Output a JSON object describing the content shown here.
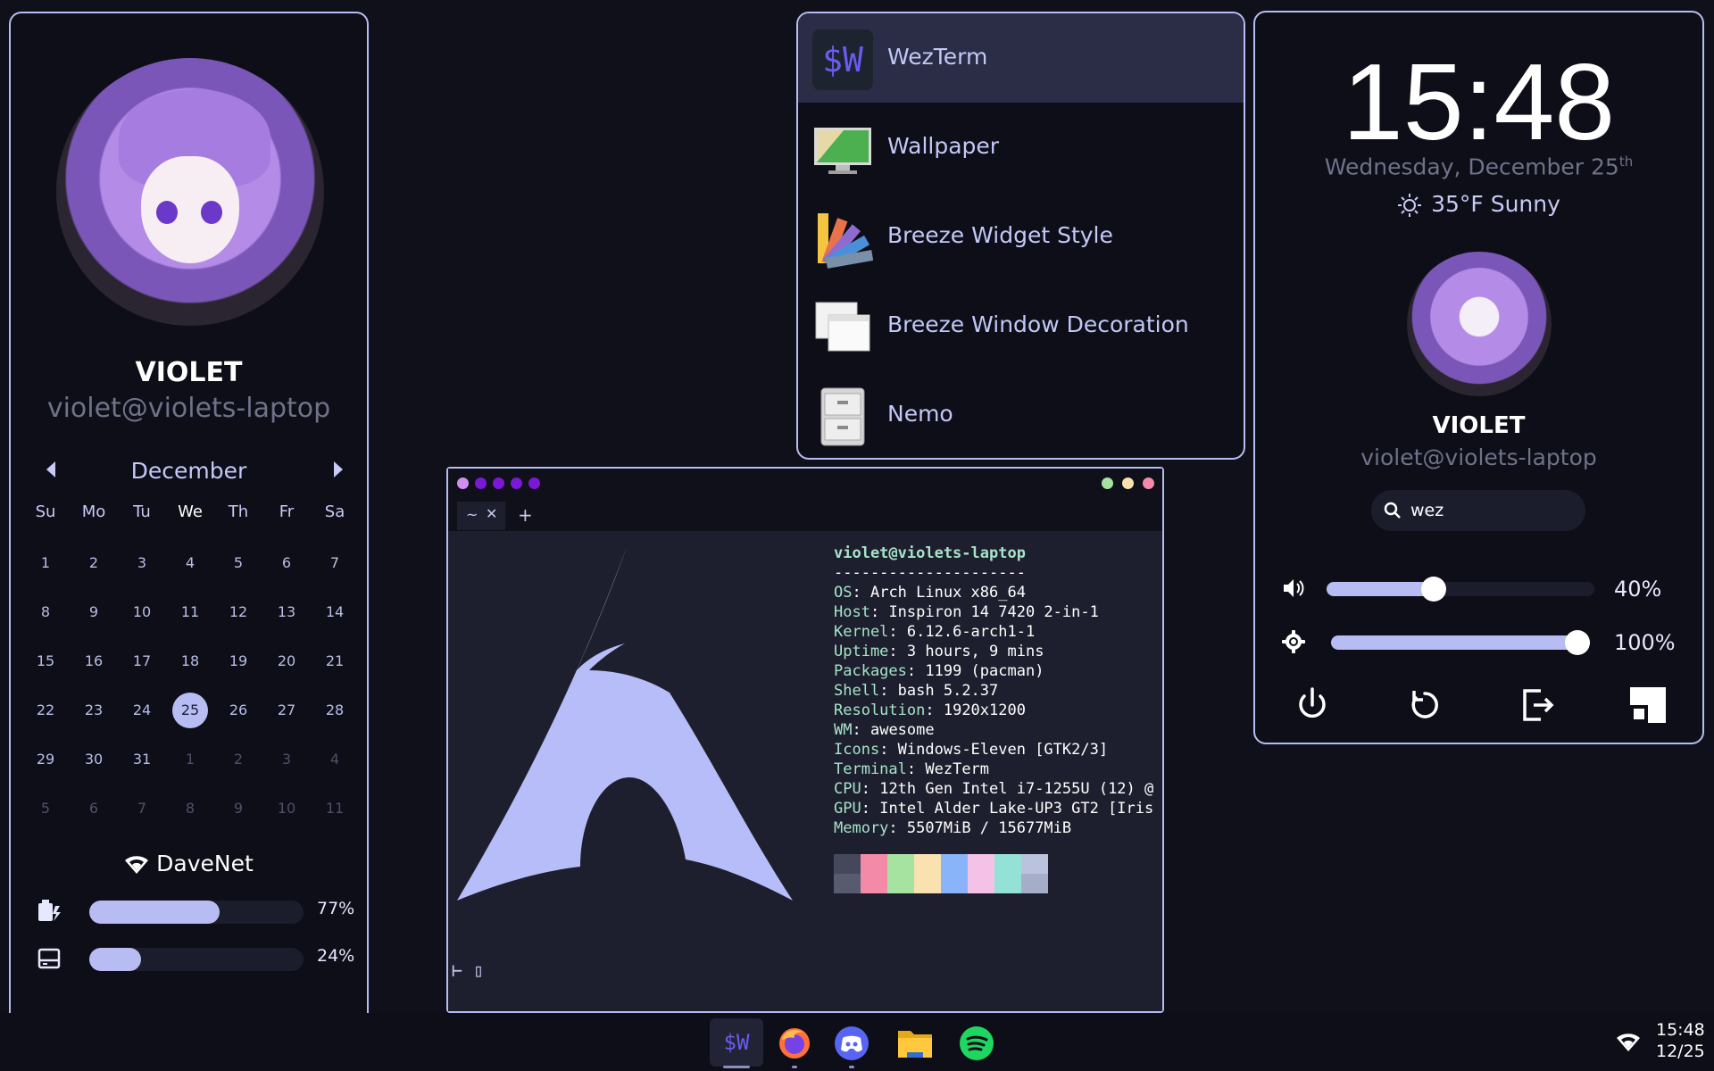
{
  "left_panel": {
    "name": "VIOLET",
    "user": "violet@violets-laptop",
    "calendar": {
      "month": "December",
      "weekdays": [
        "Su",
        "Mo",
        "Tu",
        "We",
        "Th",
        "Fr",
        "Sa"
      ],
      "days": [
        "1",
        "2",
        "3",
        "4",
        "5",
        "6",
        "7",
        "8",
        "9",
        "10",
        "11",
        "12",
        "13",
        "14",
        "15",
        "16",
        "17",
        "18",
        "19",
        "20",
        "21",
        "22",
        "23",
        "24",
        "25",
        "26",
        "27",
        "28",
        "29",
        "30",
        "31",
        "1",
        "2",
        "3",
        "4",
        "5",
        "6",
        "7",
        "8",
        "9",
        "10",
        "11"
      ],
      "today": "25"
    },
    "network": "DaveNet",
    "battery": {
      "value": "77%",
      "fraction": 0.77
    },
    "disk": {
      "value": "24%",
      "fraction": 0.24
    }
  },
  "launcher": {
    "items": [
      {
        "label": "WezTerm",
        "icon": "wezterm-icon"
      },
      {
        "label": "Wallpaper",
        "icon": "wallpaper-icon"
      },
      {
        "label": "Breeze Widget Style",
        "icon": "color-palette-icon"
      },
      {
        "label": "Breeze Window Decoration",
        "icon": "window-icon"
      },
      {
        "label": "Nemo",
        "icon": "file-cabinet-icon"
      }
    ]
  },
  "terminal": {
    "tab_label": "~",
    "user_host": "violet@violets-laptop",
    "separator": "---------------------",
    "info": [
      {
        "k": "OS",
        "v": "Arch Linux x86_64"
      },
      {
        "k": "Host",
        "v": "Inspiron 14 7420 2-in-1"
      },
      {
        "k": "Kernel",
        "v": "6.12.6-arch1-1"
      },
      {
        "k": "Uptime",
        "v": "3 hours, 9 mins"
      },
      {
        "k": "Packages",
        "v": "1199 (pacman)"
      },
      {
        "k": "Shell",
        "v": "bash 5.2.37"
      },
      {
        "k": "Resolution",
        "v": "1920x1200"
      },
      {
        "k": "WM",
        "v": "awesome"
      },
      {
        "k": "Icons",
        "v": "Windows-Eleven [GTK2/3]"
      },
      {
        "k": "Terminal",
        "v": "WezTerm"
      },
      {
        "k": "CPU",
        "v": "12th Gen Intel i7-1255U (12) @"
      },
      {
        "k": "GPU",
        "v": "Intel Alder Lake-UP3 GT2 [Iris"
      },
      {
        "k": "Memory",
        "v": "5507MiB / 15677MiB"
      }
    ],
    "swatches_top": [
      "#45475a",
      "#f38ba8",
      "#a6e3a1",
      "#f9e2af",
      "#89b4fa",
      "#f5c2e7",
      "#94e2d5",
      "#bac2de"
    ],
    "swatches_bottom": [
      "#585b70",
      "#f38ba8",
      "#a6e3a1",
      "#f9e2af",
      "#89b4fa",
      "#f5c2e7",
      "#94e2d5",
      "#a6adc8"
    ],
    "prompt": "⊢ ▯"
  },
  "right_panel": {
    "time": "15:48",
    "date": "Wednesday, December 25",
    "date_suffix": "th",
    "weather": "35°F Sunny",
    "name": "VIOLET",
    "user": "violet@violets-laptop",
    "search_value": "wez",
    "volume": {
      "value": "40%",
      "fraction": 0.4
    },
    "brightness": {
      "value": "100%",
      "fraction": 1.0
    }
  },
  "taskbar": {
    "apps": [
      "wezterm",
      "firefox",
      "discord",
      "files",
      "spotify"
    ],
    "time": "15:48",
    "date": "12/25"
  },
  "colors": {
    "accent": "#b7bdf2",
    "background": "#0f1019",
    "panel": "#0d0e17"
  }
}
